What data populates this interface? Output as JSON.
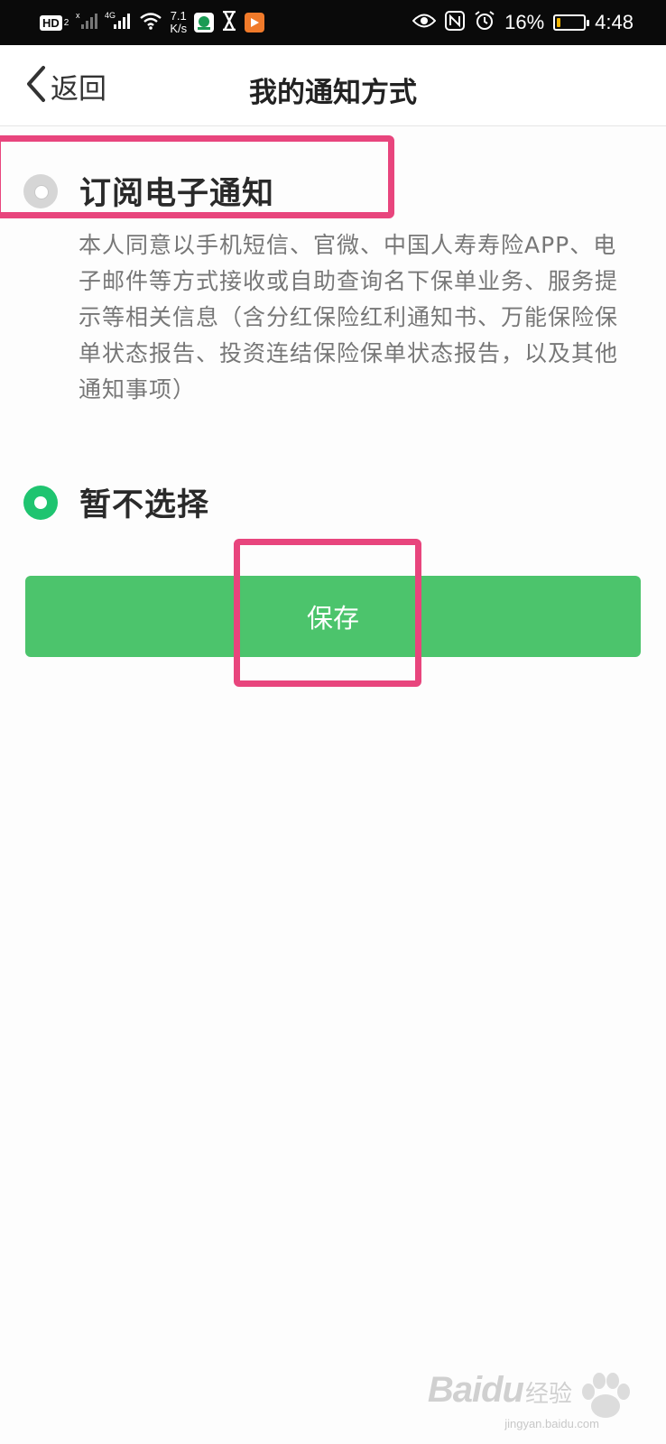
{
  "status_bar": {
    "hd": "HD",
    "hd_sub": "2",
    "network": "4G",
    "speed_value": "7.1",
    "speed_unit": "K/s",
    "battery_percent": "16%",
    "battery_level": 0.16,
    "time": "4:48",
    "icons": [
      "signal-icon",
      "wifi-icon",
      "app-icon",
      "hourglass-icon",
      "video-app-icon",
      "eye-icon",
      "nfc-icon",
      "alarm-icon",
      "battery-icon"
    ]
  },
  "nav": {
    "back_label": "返回",
    "title": "我的通知方式"
  },
  "options": [
    {
      "label": "订阅电子通知",
      "selected": false
    },
    {
      "label": "暂不选择",
      "selected": true
    }
  ],
  "description": "本人同意以手机短信、官微、中国人寿寿险APP、电子邮件等方式接收或自助查询名下保单业务、服务提示等相关信息（含分红保险红利通知书、万能保险保单状态报告、投资连结保险保单状态报告，以及其他通知事项）",
  "save_button": "保存",
  "watermark": {
    "logo": "Baidu",
    "logo_cn": "经验",
    "url": "jingyan.baidu.com"
  },
  "colors": {
    "accent_green": "#4cc46c",
    "radio_green": "#1fc470",
    "highlight": "#e8457d"
  }
}
